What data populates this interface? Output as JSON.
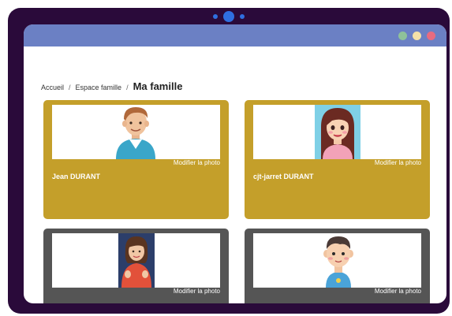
{
  "breadcrumb": {
    "home": "Accueil",
    "separator": "/",
    "family_space": "Espace famille",
    "current": "Ma famille"
  },
  "members": [
    {
      "name": "Jean DURANT",
      "photo_action": "Modifier la photo",
      "avatar": "man-avatar-icon",
      "card_color": "#c49f2a"
    },
    {
      "name": "cjt-jarret DURANT",
      "photo_action": "Modifier la photo",
      "avatar": "woman-avatar-icon",
      "card_color": "#c49f2a"
    },
    {
      "name": "",
      "photo_action": "Modifier la photo",
      "avatar": "girl-photo",
      "card_color": "#555555"
    },
    {
      "name": "",
      "photo_action": "Modifier la photo",
      "avatar": "boy-avatar-icon",
      "card_color": "#555555"
    }
  ],
  "colors": {
    "device_frame": "#2a0a3a",
    "titlebar": "#6b80c4",
    "card_gold": "#c49f2a",
    "card_dark": "#555555"
  }
}
